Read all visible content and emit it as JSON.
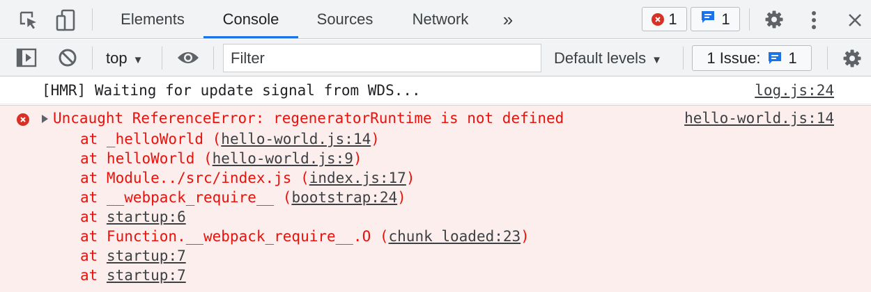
{
  "tabbar": {
    "tabs": [
      {
        "label": "Elements",
        "active": false
      },
      {
        "label": "Console",
        "active": true
      },
      {
        "label": "Sources",
        "active": false
      },
      {
        "label": "Network",
        "active": false
      }
    ],
    "more": "»",
    "errors_count": "1",
    "messages_count": "1",
    "icons": [
      "inspect-element-icon",
      "device-toolbar-icon",
      "chevron-more-icon",
      "settings-gear-icon",
      "kebab-menu-icon",
      "close-icon"
    ]
  },
  "toolbar": {
    "context": "top",
    "filter_placeholder": "Filter",
    "levels": "Default levels",
    "issues_label": "1 Issue:",
    "issues_count": "1",
    "icons": [
      "sidebar-toggle-icon",
      "clear-console-icon",
      "live-expression-eye-icon",
      "console-settings-gear-icon"
    ]
  },
  "console": {
    "info": {
      "text": "[HMR] Waiting for update signal from WDS...",
      "source": "log.js:24"
    },
    "error": {
      "message": "Uncaught ReferenceError: regeneratorRuntime is not defined",
      "source": "hello-world.js:14",
      "stack": [
        {
          "prefix": "at _helloWorld (",
          "link": "hello-world.js:14",
          "suffix": ")"
        },
        {
          "prefix": "at helloWorld (",
          "link": "hello-world.js:9",
          "suffix": ")"
        },
        {
          "prefix": "at Module../src/index.js (",
          "link": "index.js:17",
          "suffix": ")"
        },
        {
          "prefix": "at __webpack_require__ (",
          "link": "bootstrap:24",
          "suffix": ")"
        },
        {
          "prefix": "at ",
          "link": "startup:6",
          "suffix": ""
        },
        {
          "prefix": "at Function.__webpack_require__.O (",
          "link": "chunk loaded:23",
          "suffix": ")"
        },
        {
          "prefix": "at ",
          "link": "startup:7",
          "suffix": ""
        },
        {
          "prefix": "at ",
          "link": "startup:7",
          "suffix": ""
        }
      ]
    }
  },
  "colors": {
    "error_text": "#e8120c",
    "error_bg": "#fdeeee",
    "accent": "#1a73e8",
    "error_badge": "#d93025"
  }
}
